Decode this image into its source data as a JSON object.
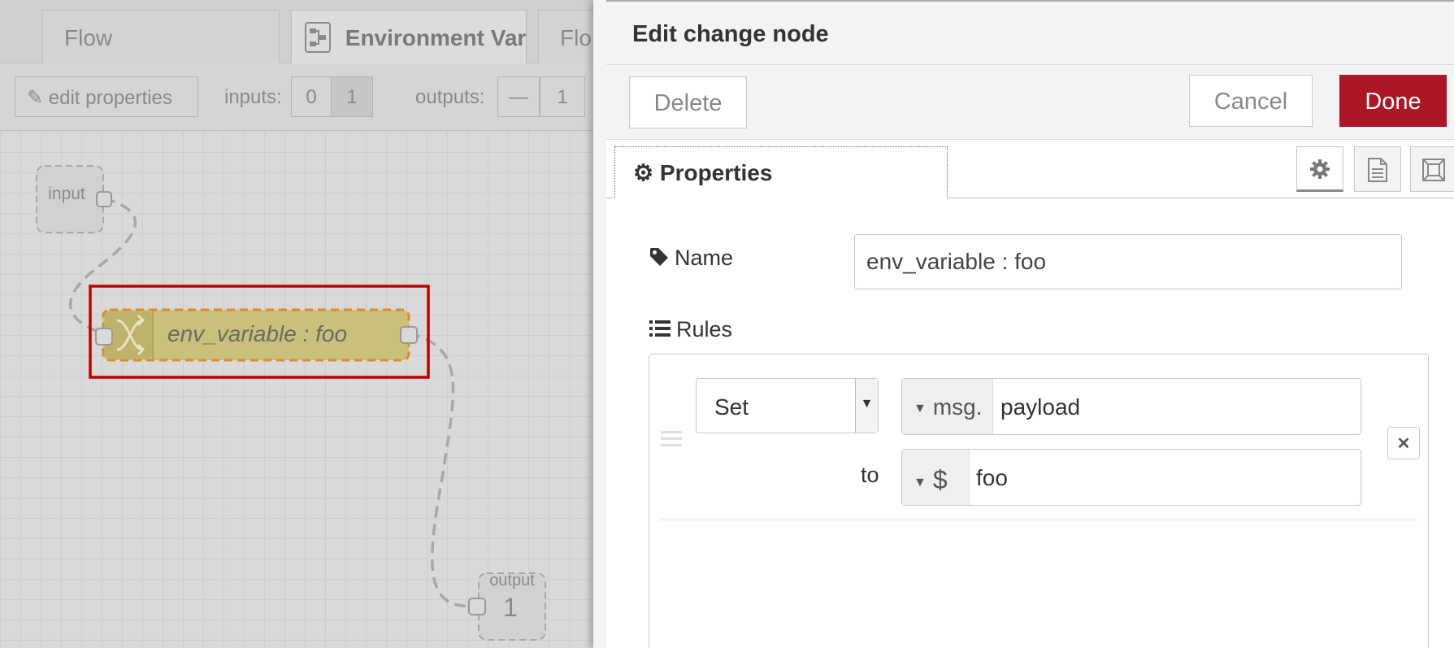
{
  "workspace": {
    "tabs": [
      {
        "label": "Flow",
        "active": false
      },
      {
        "label": "Environment Vari",
        "active": true
      },
      {
        "label": "Flo",
        "active": false
      }
    ],
    "toolbar": {
      "edit_properties_label": "edit properties",
      "inputs_label": "inputs:",
      "inputs_options": [
        "0",
        "1"
      ],
      "outputs_label": "outputs:",
      "outputs_minus": "—",
      "outputs_value": "1"
    },
    "nodes": {
      "input_label": "input",
      "change_node_label": "env_variable : foo",
      "output_label": "output",
      "output_number": "1"
    },
    "colors": {
      "change_node_fill": "#c9c07a",
      "selection_outline": "#c00000"
    }
  },
  "tray": {
    "title": "Edit change node",
    "delete_label": "Delete",
    "cancel_label": "Cancel",
    "done_label": "Done",
    "tab_properties_label": "Properties",
    "side_tabs": [
      "gear-icon",
      "document-icon",
      "appearance-icon"
    ],
    "name_label": "Name",
    "name_value": "env_variable : foo",
    "rules_label": "Rules",
    "rule": {
      "action": "Set",
      "property_type": "msg.",
      "property_value": "payload",
      "to_label": "to",
      "value_type": "$",
      "value": "foo"
    },
    "colors": {
      "done_button": "#ad1625"
    }
  }
}
